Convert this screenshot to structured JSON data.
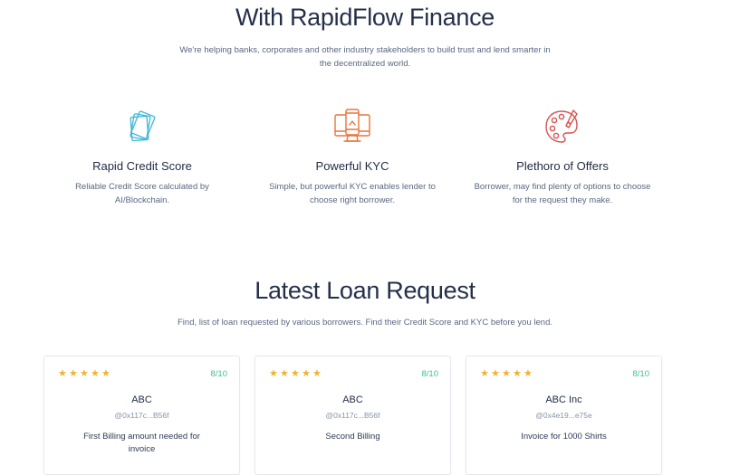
{
  "features_section": {
    "title": "With RapidFlow Finance",
    "subtitle_line1": "We're helping banks, corporates and other industry stakeholders to build trust and lend smarter in",
    "subtitle_line2": "the decentralized world.",
    "features": [
      {
        "icon": "cards-icon",
        "title": "Rapid Credit Score",
        "desc_line1": "Reliable Credit Score calculated by",
        "desc_line2": "AI/Blockchain."
      },
      {
        "icon": "monitor-phone-icon",
        "title": "Powerful KYC",
        "desc_line1": "Simple, but powerful KYC enables lender to",
        "desc_line2": "choose right borrower."
      },
      {
        "icon": "palette-icon",
        "title": "Plethoro of Offers",
        "desc_line1": "Borrower, may find plenty of options to choose",
        "desc_line2": "for the request they make."
      }
    ]
  },
  "loans_section": {
    "title": "Latest Loan Request",
    "subtitle": "Find, list of loan requested by various borrowers. Find their Credit Score and KYC before you lend.",
    "cards": [
      {
        "stars": 5,
        "rating": "8/10",
        "name": "ABC",
        "address": "@0x117c...B56f",
        "desc_line1": "First Billing amount needed for",
        "desc_line2": "invoice"
      },
      {
        "stars": 5,
        "rating": "8/10",
        "name": "ABC",
        "address": "@0x117c...B56f",
        "desc_line1": "Second Billing",
        "desc_line2": ""
      },
      {
        "stars": 5,
        "rating": "8/10",
        "name": "ABC Inc",
        "address": "@0x4e19...e75e",
        "desc_line1": "Invoice for 1000 Shirts",
        "desc_line2": ""
      }
    ]
  },
  "colors": {
    "star": "#f2b230",
    "rating": "#3fc38a",
    "icon_teal": "#3fb8d4",
    "icon_orange": "#e8743b",
    "icon_red": "#d9534f"
  }
}
